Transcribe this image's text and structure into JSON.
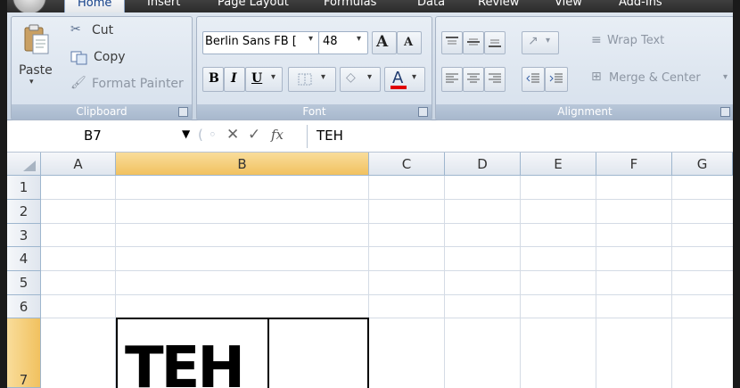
{
  "tabs": [
    "Home",
    "Insert",
    "Page Layout",
    "Formulas",
    "Data",
    "Review",
    "View",
    "Add-Ins"
  ],
  "active_tab": "Home",
  "clipboard": {
    "paste": "Paste",
    "cut": "Cut",
    "copy": "Copy",
    "format_painter": "Format Painter",
    "group_label": "Clipboard"
  },
  "font": {
    "font_name": "Berlin Sans FB [",
    "font_size": "48",
    "grow": "A",
    "shrink": "A",
    "bold": "B",
    "italic": "I",
    "underline": "U",
    "font_color_glyph": "A",
    "group_label": "Font"
  },
  "alignment": {
    "wrap_text": "Wrap Text",
    "merge_center": "Merge & Center",
    "group_label": "Alignment"
  },
  "formula_bar": {
    "name_box": "B7",
    "fx": "fx",
    "content": "TEH"
  },
  "columns": [
    "A",
    "B",
    "C",
    "D",
    "E",
    "F",
    "G"
  ],
  "selected_column": "B",
  "rows": [
    "1",
    "2",
    "3",
    "4",
    "5",
    "6",
    "7"
  ],
  "selected_row": "7",
  "cell_b7": "TEH",
  "colors": {
    "ribbon": "#c9d5e3",
    "header_selected": "#f1c15f",
    "font_color_bar": "#e00000"
  }
}
